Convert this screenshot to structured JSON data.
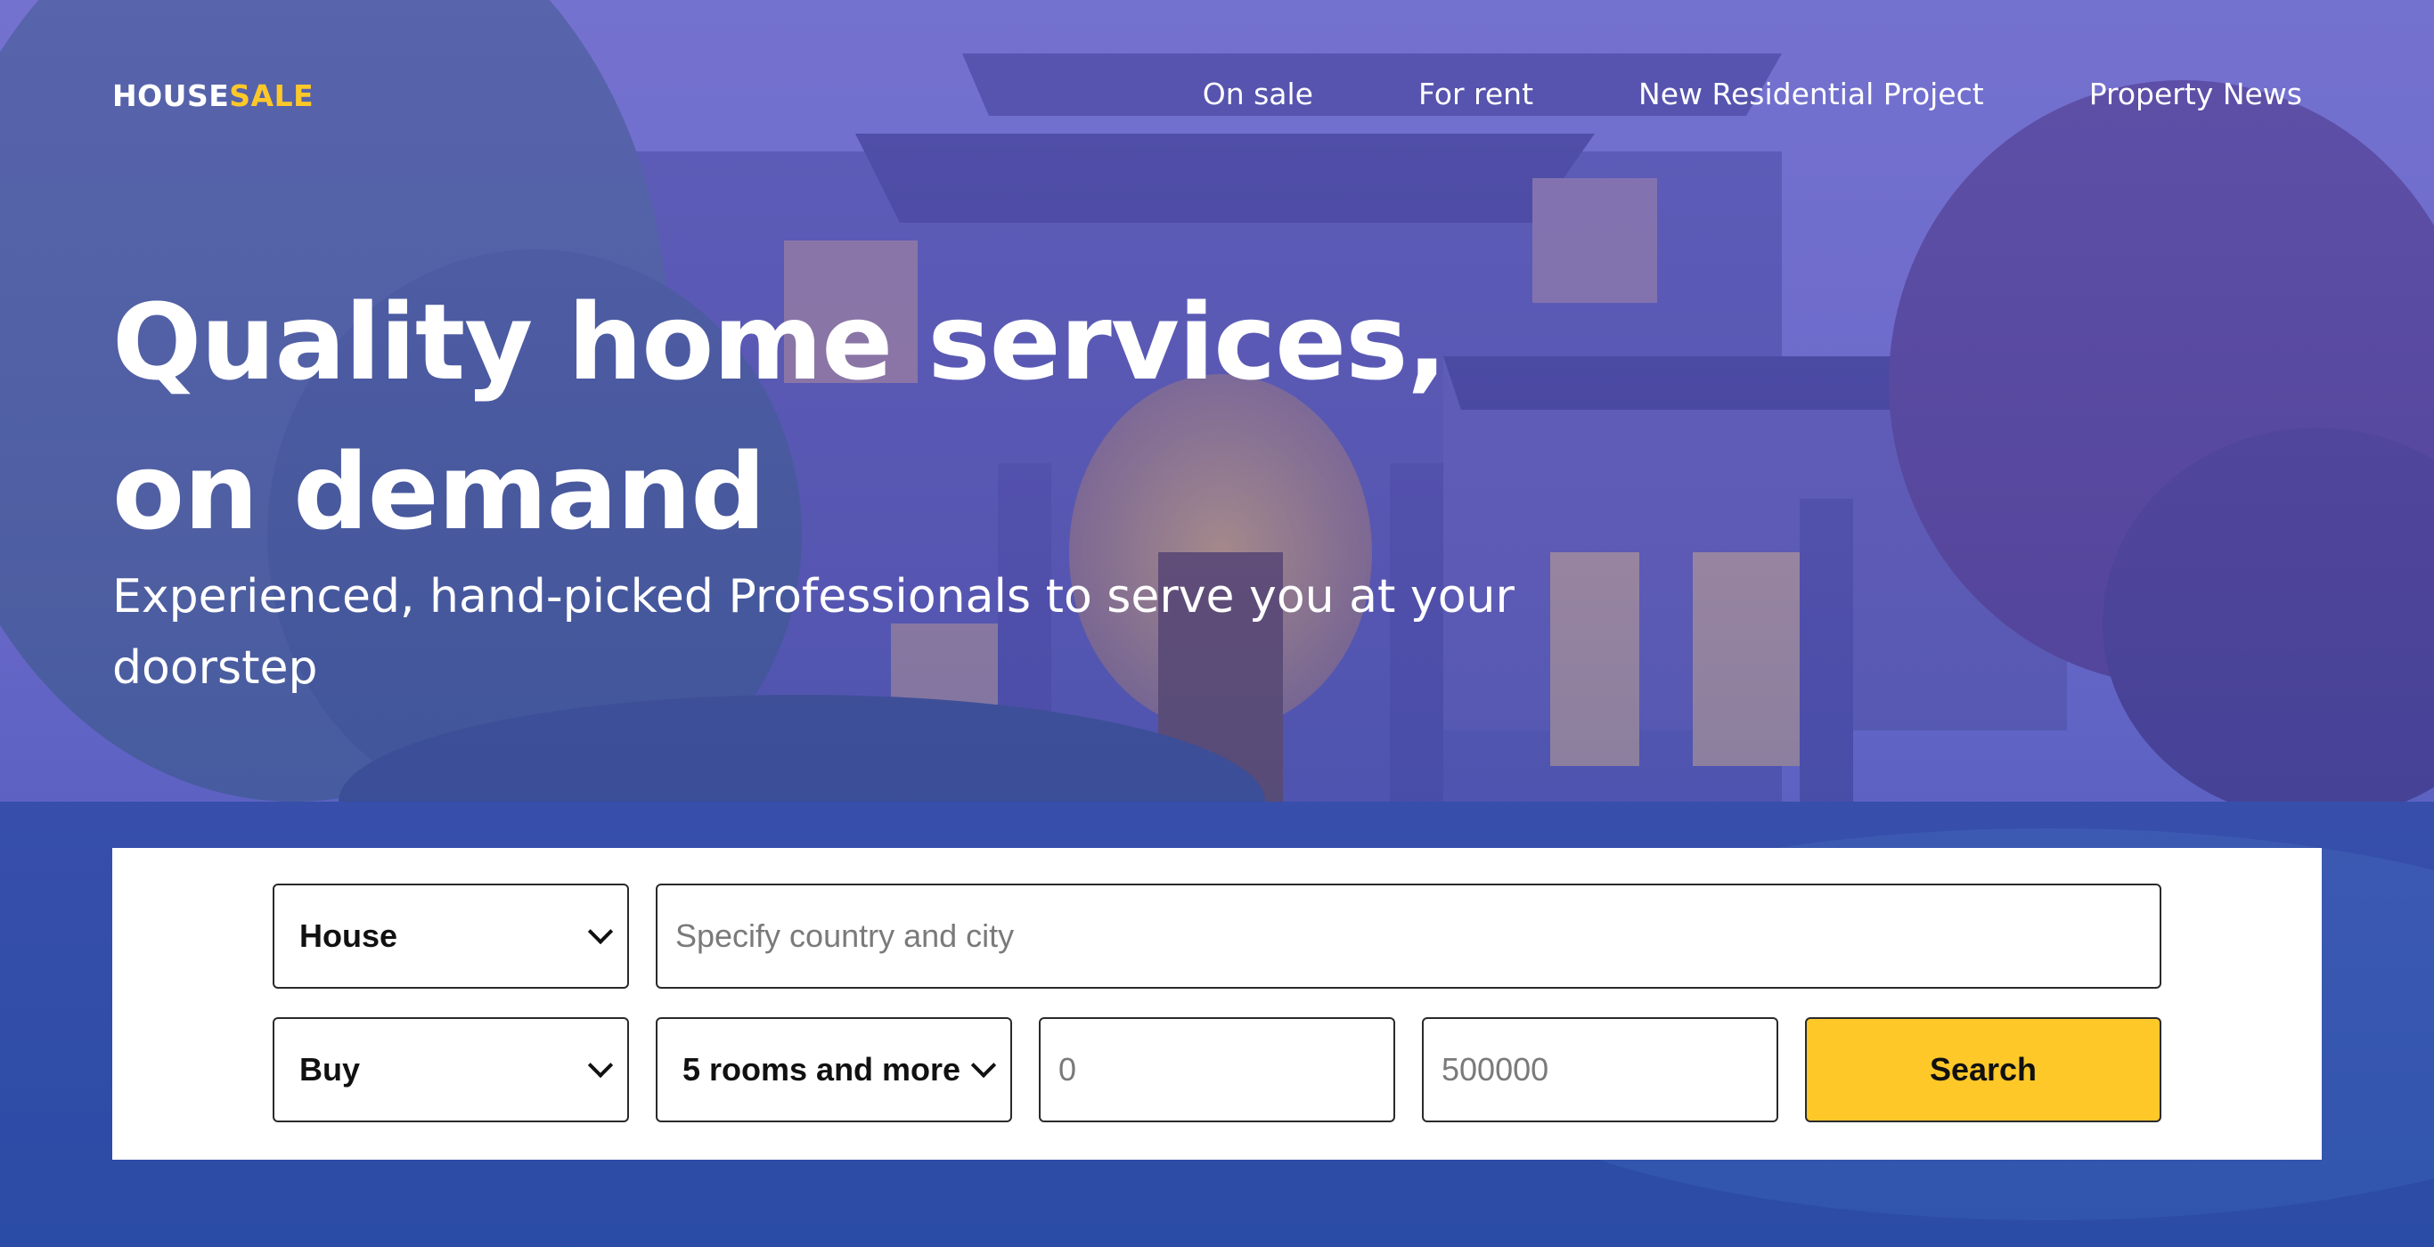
{
  "brand": {
    "logo_part1": "HOUSE",
    "logo_part2": "SALE",
    "accent_color": "#ffc829"
  },
  "nav": {
    "items": [
      {
        "label": "On sale"
      },
      {
        "label": "For rent"
      },
      {
        "label": "New Residential Project"
      },
      {
        "label": "Property News"
      }
    ]
  },
  "hero": {
    "headline_line1": "Quality home services,",
    "headline_line2": "on demand",
    "subtitle_line1": "Experienced, hand-picked Professionals to serve you at your",
    "subtitle_line2": "doorstep"
  },
  "search": {
    "property_type": {
      "value": "House",
      "icon": "chevron-down-icon"
    },
    "location": {
      "value": "",
      "placeholder": "Specify country and city"
    },
    "deal_type": {
      "value": "Buy",
      "icon": "chevron-down-icon"
    },
    "rooms": {
      "value": "5 rooms and more",
      "icon": "chevron-down-icon"
    },
    "price_min": {
      "value": "",
      "placeholder": "0"
    },
    "price_max": {
      "value": "",
      "placeholder": "500000"
    },
    "submit_label": "Search",
    "submit_color": "#ffc829"
  }
}
